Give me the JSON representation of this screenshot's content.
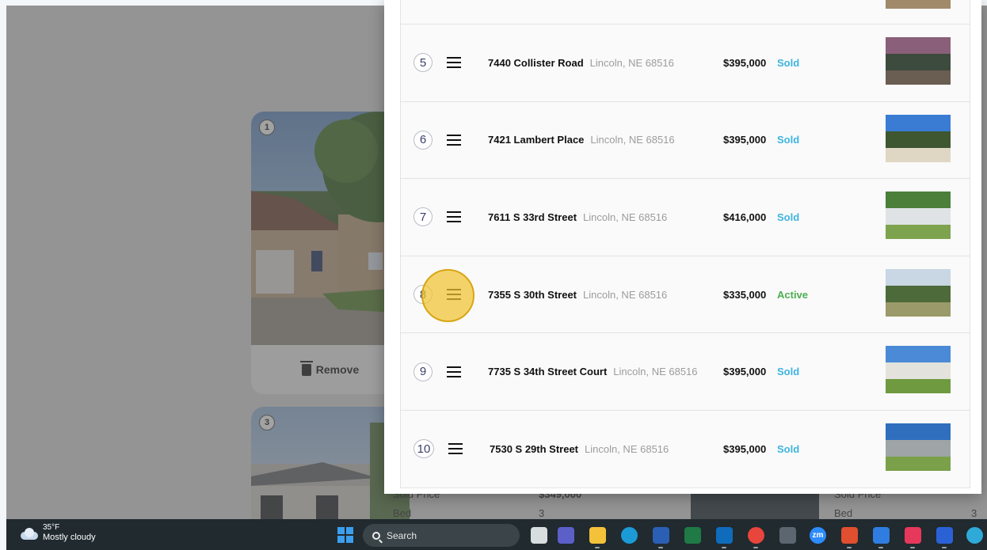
{
  "background": {
    "cards": [
      {
        "badge": "1",
        "remove_label": "Remove"
      },
      {
        "badge": "3"
      }
    ],
    "partial_labels": {
      "sold_price": "Sold Price",
      "sold_price_value": "$349,000",
      "bed": "Bed",
      "bed_value": "3",
      "sold_price_right": "Sold Price",
      "bed_right": "Bed",
      "bed_right_value": "3"
    }
  },
  "rows": [
    {
      "rank": "5",
      "street": "7440 Collister Road",
      "city": "Lincoln, NE 68516",
      "price": "$395,000",
      "status": "Sold"
    },
    {
      "rank": "6",
      "street": "7421 Lambert Place",
      "city": "Lincoln, NE 68516",
      "price": "$395,000",
      "status": "Sold"
    },
    {
      "rank": "7",
      "street": "7611 S 33rd Street",
      "city": "Lincoln, NE 68516",
      "price": "$416,000",
      "status": "Sold"
    },
    {
      "rank": "8",
      "street": "7355 S 30th Street",
      "city": "Lincoln, NE 68516",
      "price": "$335,000",
      "status": "Active"
    },
    {
      "rank": "9",
      "street": "7735 S 34th Street Court",
      "city": "Lincoln, NE 68516",
      "price": "$395,000",
      "status": "Sold"
    },
    {
      "rank": "10",
      "street": "7530 S 29th Street",
      "city": "Lincoln, NE 68516",
      "price": "$395,000",
      "status": "Sold"
    }
  ],
  "colors": {
    "sold": "#3cb4e0",
    "active": "#4caf50",
    "click_highlight": "#f0c431"
  },
  "taskbar": {
    "weather_temp": "35°F",
    "weather_desc": "Mostly cloudy",
    "search_label": "Search",
    "zoom_label": "zm",
    "apps": [
      "windows-start-icon",
      "file-explorer-task-icon",
      "teams-icon",
      "folder-icon",
      "edge-icon",
      "word-icon",
      "excel-icon",
      "outlook-icon",
      "chrome-icon",
      "calculator-icon",
      "zoom-icon",
      "slides-icon",
      "app-r-icon",
      "app-pink-icon",
      "app-blue-icon",
      "copilot-icon"
    ]
  }
}
